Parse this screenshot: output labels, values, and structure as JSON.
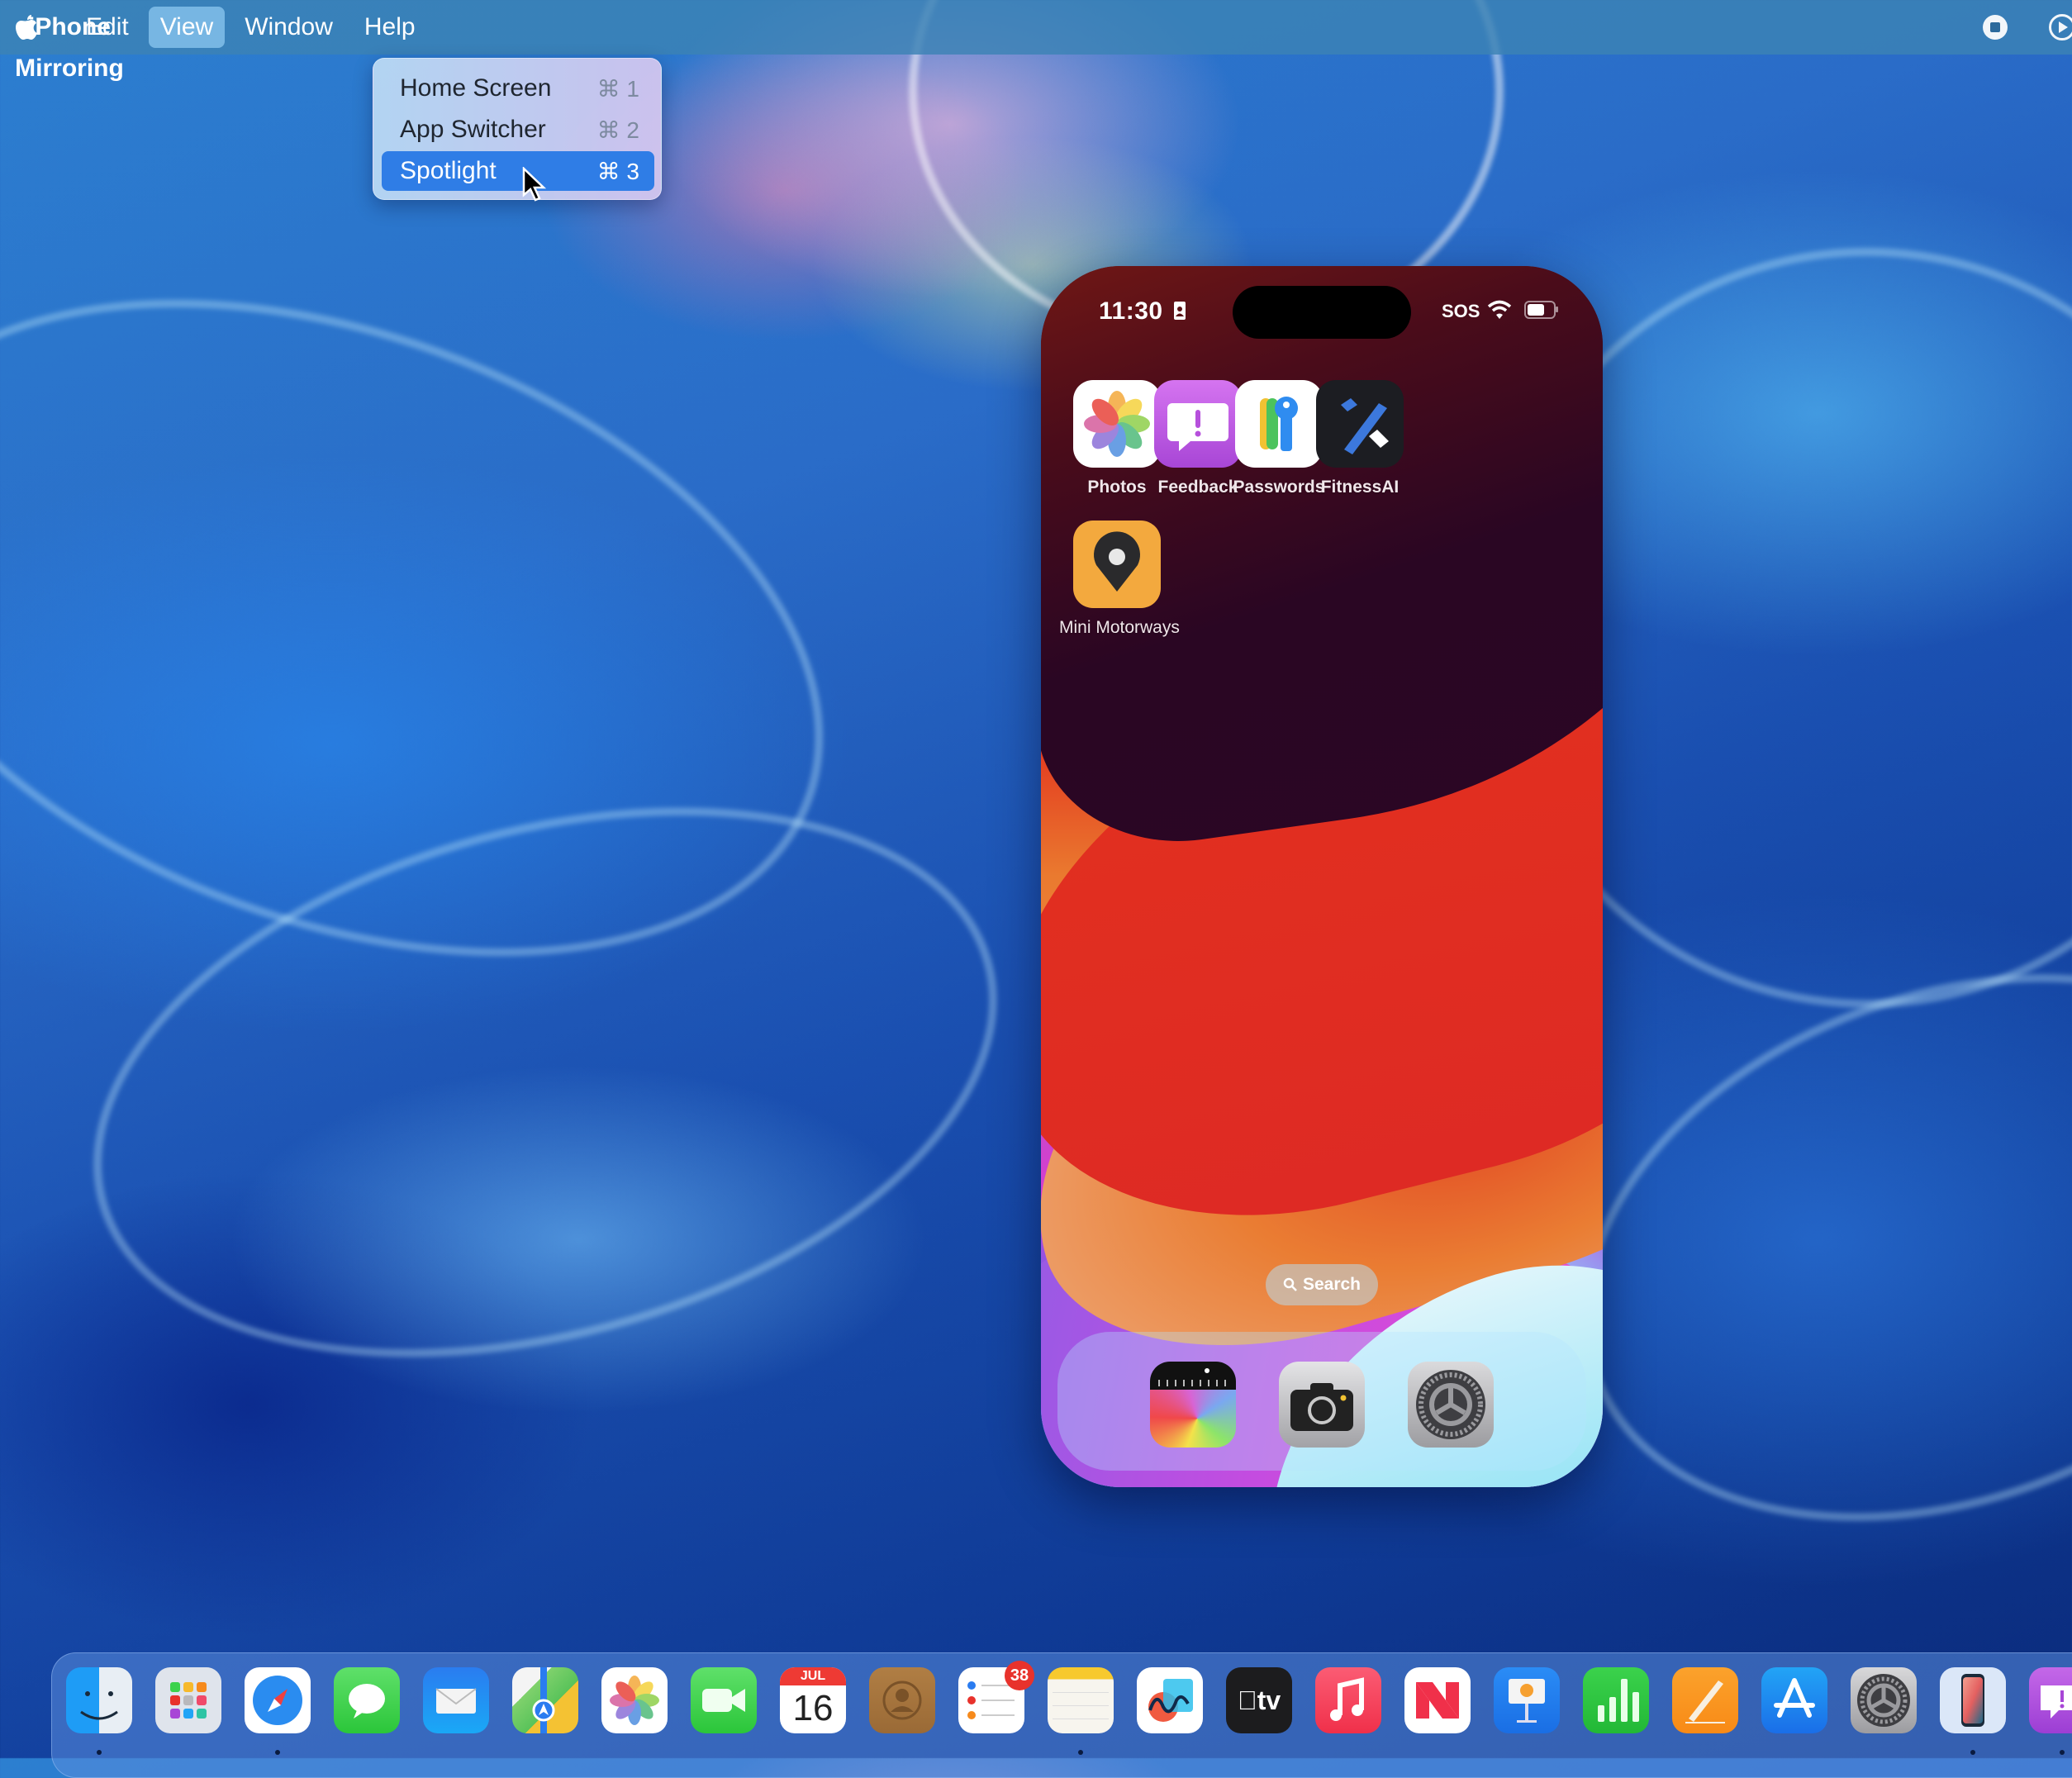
{
  "menubar": {
    "apple_icon": "apple-logo",
    "app_name": "iPhone Mirroring",
    "menus": [
      "Edit",
      "View",
      "Window",
      "Help"
    ],
    "active_menu": "View",
    "status_icons": [
      "screen-recording-stop",
      "play-circle"
    ]
  },
  "view_menu": {
    "items": [
      {
        "label": "Home Screen",
        "shortcut": "⌘ 1",
        "selected": false
      },
      {
        "label": "App Switcher",
        "shortcut": "⌘ 2",
        "selected": false
      },
      {
        "label": "Spotlight",
        "shortcut": "⌘ 3",
        "selected": true
      }
    ]
  },
  "iphone": {
    "status_bar": {
      "time": "11:30",
      "carrier": "SOS",
      "wifi_icon": "wifi",
      "battery_icon": "battery"
    },
    "home_apps": [
      {
        "label": "Photos",
        "icon": "photos"
      },
      {
        "label": "Feedback",
        "icon": "feedback"
      },
      {
        "label": "Passwords",
        "icon": "passwords"
      },
      {
        "label": "FitnessAI",
        "icon": "fitnessai"
      },
      {
        "label": "Mini Motorways",
        "icon": "mini-motorways"
      }
    ],
    "search_label": "Search",
    "dock_apps": [
      {
        "label": "Measure",
        "icon": "measure"
      },
      {
        "label": "Camera",
        "icon": "camera"
      },
      {
        "label": "Settings",
        "icon": "settings"
      }
    ]
  },
  "dock": {
    "apps": [
      {
        "name": "Finder",
        "running": true
      },
      {
        "name": "Launchpad",
        "running": false
      },
      {
        "name": "Safari",
        "running": true
      },
      {
        "name": "Messages",
        "running": false
      },
      {
        "name": "Mail",
        "running": false
      },
      {
        "name": "Maps",
        "running": false
      },
      {
        "name": "Photos",
        "running": false
      },
      {
        "name": "FaceTime",
        "running": false
      },
      {
        "name": "Calendar",
        "running": false,
        "month": "JUL",
        "day": "16"
      },
      {
        "name": "Contacts",
        "running": false
      },
      {
        "name": "Reminders",
        "running": false,
        "badge": "38"
      },
      {
        "name": "Notes",
        "running": true
      },
      {
        "name": "Freeform",
        "running": false
      },
      {
        "name": "TV",
        "running": false,
        "text": "tv"
      },
      {
        "name": "Music",
        "running": false
      },
      {
        "name": "News",
        "running": false
      },
      {
        "name": "Keynote",
        "running": false
      },
      {
        "name": "Numbers",
        "running": false
      },
      {
        "name": "Pages",
        "running": false
      },
      {
        "name": "App Store",
        "running": false
      },
      {
        "name": "System Settings",
        "running": false
      },
      {
        "name": "iPhone Mirroring",
        "running": true
      },
      {
        "name": "Feedback Assistant",
        "running": true
      }
    ]
  },
  "colors": {
    "menu_highlight": "#2f7de6",
    "badge": "#e8322c"
  }
}
